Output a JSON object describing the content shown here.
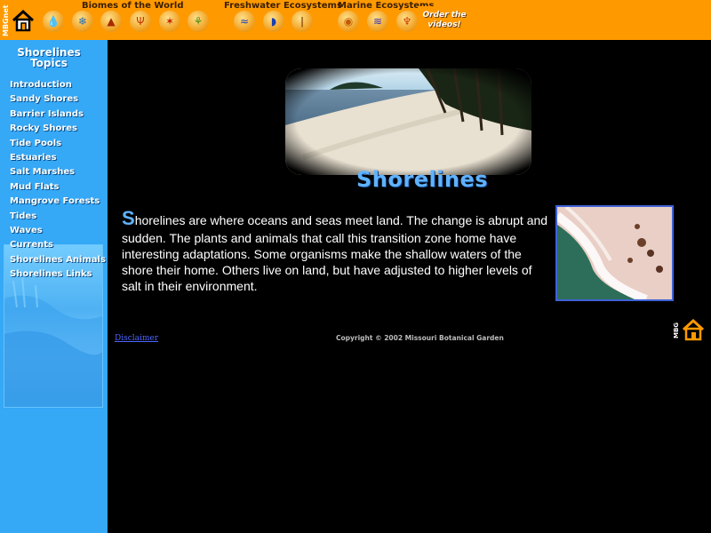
{
  "topnav": {
    "sections": [
      {
        "label": "Biomes of the World"
      },
      {
        "label": "Freshwater Ecosystems"
      },
      {
        "label": "Marine Ecosystems"
      }
    ],
    "logo_text": "MBGnet",
    "order_label_1": "Order the",
    "order_label_2": "videos!",
    "icons": [
      "home-icon",
      "drop-icon",
      "snowflake-icon",
      "tree-icon",
      "cactus-icon",
      "leaf-icon",
      "grass-icon",
      "river-icon",
      "lake-icon",
      "wetland-icon",
      "shell-icon",
      "wave-icon",
      "coral-icon"
    ]
  },
  "sidebar": {
    "title_1": "Shorelines",
    "title_2": "Topics",
    "items": [
      {
        "label": "Introduction"
      },
      {
        "label": "Sandy Shores"
      },
      {
        "label": "Barrier Islands"
      },
      {
        "label": "Rocky Shores"
      },
      {
        "label": "Tide Pools"
      },
      {
        "label": "Estuaries"
      },
      {
        "label": "Salt Marshes"
      },
      {
        "label": "Mud Flats"
      },
      {
        "label": "Mangrove Forests"
      },
      {
        "label": "Tides"
      },
      {
        "label": "Waves"
      },
      {
        "label": "Currents"
      },
      {
        "label": "Shorelines Animals"
      },
      {
        "label": "Shorelines Links"
      }
    ]
  },
  "main": {
    "title": "Shorelines",
    "intro_first_letter": "S",
    "intro_rest": "horelines are where oceans and seas meet land. The change is abrupt and sudden. The plants and animals that call this transition zone home have interesting adaptations. Some organisms make the shallow waters of the shore their home. Others live on land, but have adjusted to higher levels of salt in their environment.",
    "disclaimer": "Disclaimer",
    "copyright": "Copyright © 2002 Missouri Botanical Garden"
  },
  "colors": {
    "topbar": "#ff9900",
    "sidebar": "#35a8f6",
    "title_blue": "#5fb2ff"
  }
}
